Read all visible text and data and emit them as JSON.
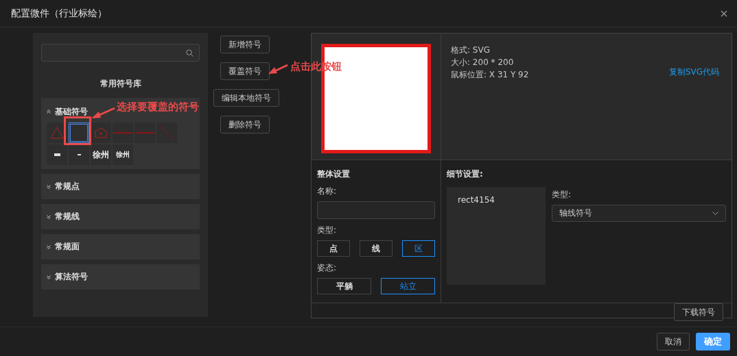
{
  "window": {
    "title": "配置微件（行业标绘）"
  },
  "library": {
    "title": "常用符号库",
    "groups": [
      {
        "label": "基础符号",
        "expanded": true,
        "symbols": [
          {
            "kind": "triangle",
            "selected": false
          },
          {
            "kind": "square",
            "selected": true
          },
          {
            "kind": "house",
            "selected": false
          },
          {
            "kind": "line",
            "selected": false
          },
          {
            "kind": "line",
            "selected": false
          },
          {
            "kind": "diagonal",
            "selected": false
          },
          {
            "kind": "tinytext",
            "selected": false
          },
          {
            "kind": "dash",
            "selected": false
          },
          {
            "kind": "bigtext",
            "text": "徐州",
            "selected": false
          },
          {
            "kind": "smalltext",
            "text": "徐州",
            "selected": false
          }
        ]
      },
      {
        "label": "常规点",
        "expanded": false
      },
      {
        "label": "常规线",
        "expanded": false
      },
      {
        "label": "常规面",
        "expanded": false
      },
      {
        "label": "算法符号",
        "expanded": false
      }
    ]
  },
  "actions": [
    "新增符号",
    "覆盖符号",
    "编辑本地符号",
    "删除符号"
  ],
  "preview": {
    "format": "格式: SVG",
    "size": "大小: 200 * 200",
    "mouse": "鼠标位置: X 31 Y 92",
    "copy_link": "复制SVG代码"
  },
  "overall": {
    "title": "整体设置",
    "name_label": "名称:",
    "type_label": "类型:",
    "types": [
      {
        "label": "点",
        "selected": false
      },
      {
        "label": "线",
        "selected": false
      },
      {
        "label": "区",
        "selected": true
      }
    ],
    "pose_label": "姿态:",
    "poses": [
      {
        "label": "平躺",
        "selected": false
      },
      {
        "label": "站立",
        "selected": true
      }
    ]
  },
  "detail": {
    "title": "细节设置:",
    "elements": [
      "rect4154"
    ],
    "type_label": "类型:",
    "type_value": "轴线符号"
  },
  "download": "下载符号",
  "footer": {
    "cancel": "取消",
    "ok": "确定"
  },
  "annotations": [
    {
      "kind": "symbol",
      "text": "选择要覆盖的符号"
    },
    {
      "kind": "button",
      "text": "点击此按钮"
    }
  ]
}
